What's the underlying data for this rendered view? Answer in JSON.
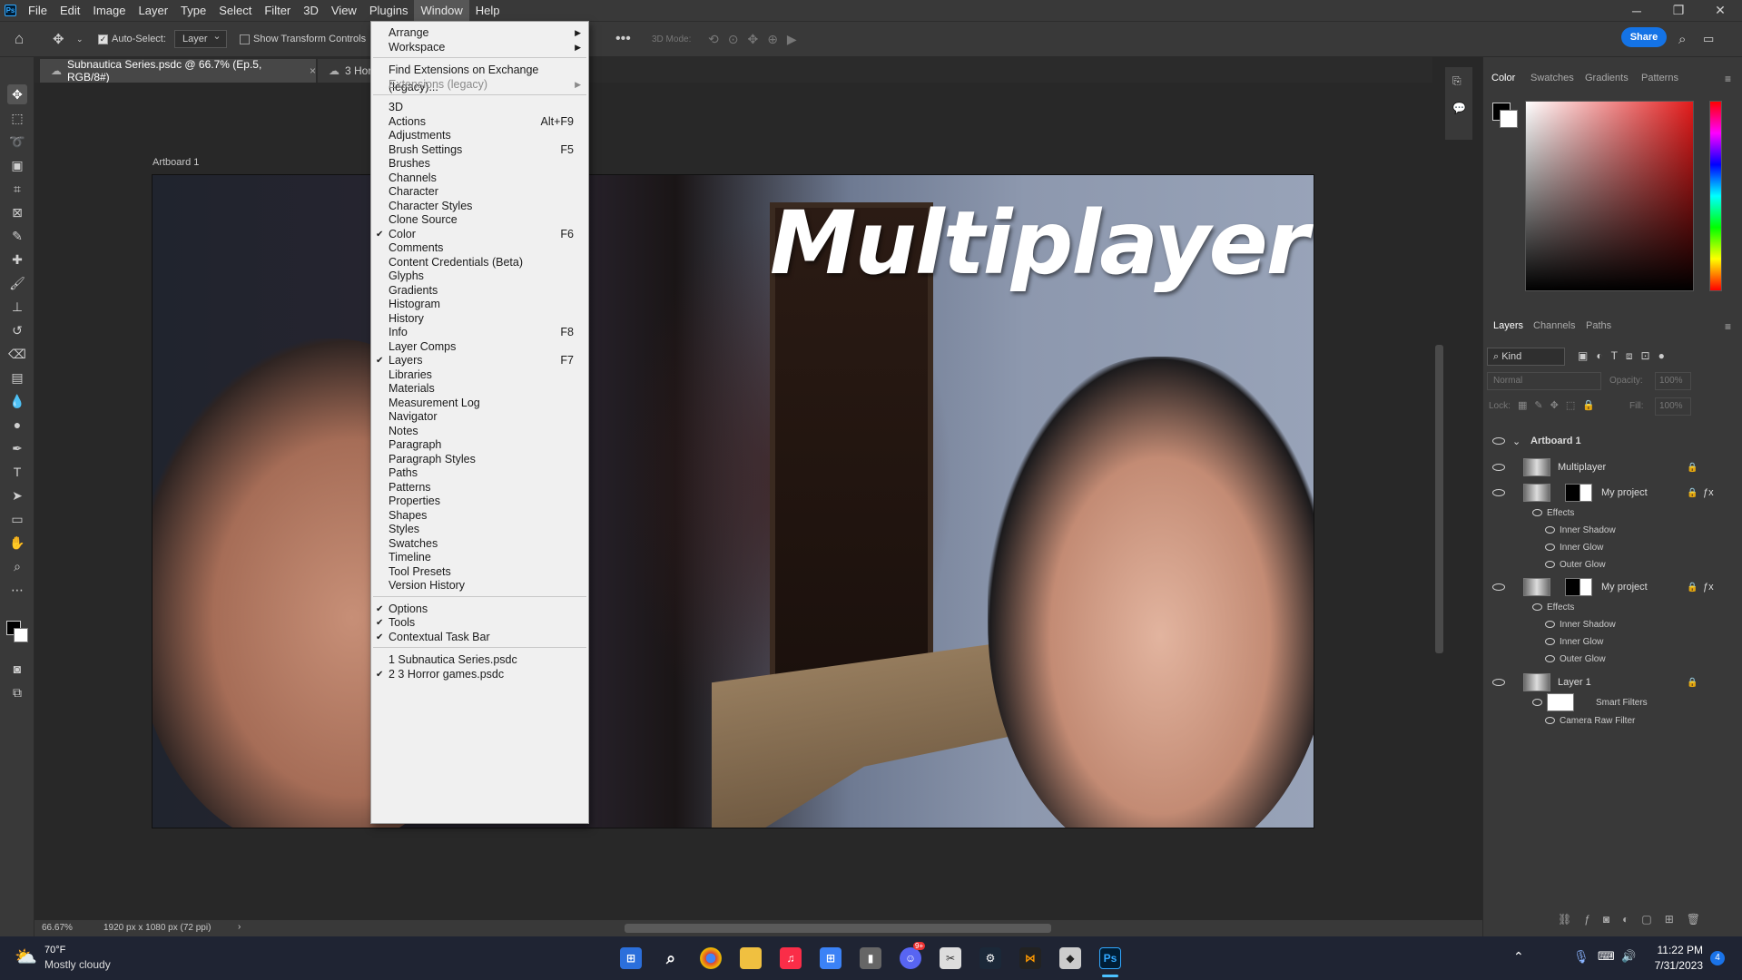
{
  "menubar": {
    "app_badge": "Ps",
    "items": [
      "File",
      "Edit",
      "Image",
      "Layer",
      "Type",
      "Select",
      "Filter",
      "3D",
      "View",
      "Plugins",
      "Window",
      "Help"
    ],
    "active": "Window"
  },
  "options": {
    "auto_select_label": "Auto-Select:",
    "auto_select_target": "Layer",
    "transform_controls_label": "Show Transform Controls",
    "mode_3d_label": "3D Mode:",
    "share_label": "Share"
  },
  "tabs": [
    {
      "label": "Subnautica Series.psdc @ 66.7% (Ep.5, RGB/8#)"
    },
    {
      "label": "3 Hor"
    }
  ],
  "canvas": {
    "artboard_label": "Artboard 1",
    "overlay_title": "Multiplayer"
  },
  "window_menu": {
    "groups": [
      [
        {
          "label": "Arrange",
          "submenu": true
        },
        {
          "label": "Workspace",
          "submenu": true
        }
      ],
      [
        {
          "label": "Find Extensions on Exchange (legacy)..."
        },
        {
          "label": "Extensions (legacy)",
          "submenu": true,
          "disabled": true
        }
      ],
      [
        {
          "label": "3D"
        },
        {
          "label": "Actions",
          "shortcut": "Alt+F9"
        },
        {
          "label": "Adjustments"
        },
        {
          "label": "Brush Settings",
          "shortcut": "F5"
        },
        {
          "label": "Brushes"
        },
        {
          "label": "Channels"
        },
        {
          "label": "Character"
        },
        {
          "label": "Character Styles"
        },
        {
          "label": "Clone Source"
        },
        {
          "label": "Color",
          "shortcut": "F6",
          "checked": true
        },
        {
          "label": "Comments"
        },
        {
          "label": "Content Credentials (Beta)"
        },
        {
          "label": "Glyphs"
        },
        {
          "label": "Gradients"
        },
        {
          "label": "Histogram"
        },
        {
          "label": "History"
        },
        {
          "label": "Info",
          "shortcut": "F8"
        },
        {
          "label": "Layer Comps"
        },
        {
          "label": "Layers",
          "shortcut": "F7",
          "checked": true
        },
        {
          "label": "Libraries"
        },
        {
          "label": "Materials"
        },
        {
          "label": "Measurement Log"
        },
        {
          "label": "Navigator"
        },
        {
          "label": "Notes"
        },
        {
          "label": "Paragraph"
        },
        {
          "label": "Paragraph Styles"
        },
        {
          "label": "Paths"
        },
        {
          "label": "Patterns"
        },
        {
          "label": "Properties"
        },
        {
          "label": "Shapes"
        },
        {
          "label": "Styles"
        },
        {
          "label": "Swatches"
        },
        {
          "label": "Timeline"
        },
        {
          "label": "Tool Presets"
        },
        {
          "label": "Version History"
        }
      ],
      [
        {
          "label": "Options",
          "checked": true
        },
        {
          "label": "Tools",
          "checked": true
        },
        {
          "label": "Contextual Task Bar",
          "checked": true
        }
      ],
      [
        {
          "label": "1 Subnautica Series.psdc"
        },
        {
          "label": "2 3 Horror games.psdc",
          "checked": true
        }
      ]
    ]
  },
  "color_panel": {
    "tabs": [
      "Color",
      "Swatches",
      "Gradients",
      "Patterns"
    ],
    "active": "Color"
  },
  "layers_panel": {
    "tabs": [
      "Layers",
      "Channels",
      "Paths"
    ],
    "active": "Layers",
    "kind_label": "Kind",
    "blend_mode": "Normal",
    "opacity_label": "Opacity:",
    "opacity_value": "100%",
    "lock_label": "Lock:",
    "fill_label": "Fill:",
    "fill_value": "100%",
    "rows": [
      {
        "label": "Artboard 1",
        "type": "group"
      },
      {
        "label": "Multiplayer",
        "type": "layer"
      },
      {
        "label": "My project",
        "type": "layer",
        "fx": true
      },
      {
        "label": "Effects",
        "type": "effects"
      },
      {
        "label": "Inner Shadow",
        "type": "effect"
      },
      {
        "label": "Inner Glow",
        "type": "effect"
      },
      {
        "label": "Outer Glow",
        "type": "effect"
      },
      {
        "label": "My project",
        "type": "layer",
        "fx": true
      },
      {
        "label": "Effects",
        "type": "effects"
      },
      {
        "label": "Inner Shadow",
        "type": "effect"
      },
      {
        "label": "Inner Glow",
        "type": "effect"
      },
      {
        "label": "Outer Glow",
        "type": "effect"
      },
      {
        "label": "Layer 1",
        "type": "layer"
      },
      {
        "label": "Smart Filters",
        "type": "effects"
      },
      {
        "label": "Camera Raw Filter",
        "type": "effect"
      }
    ]
  },
  "status": {
    "zoom": "66.67%",
    "doc_info": "1920 px x 1080 px (72 ppi)"
  },
  "taskbar": {
    "weather_temp": "70°F",
    "weather_desc": "Mostly cloudy",
    "time": "11:22 PM",
    "date": "7/31/2023",
    "notification_count": "4",
    "discord_badge": "9+"
  },
  "colors": {
    "menu_bg": "#393939",
    "accent": "#1473e6",
    "ps_blue": "#31a8ff"
  }
}
